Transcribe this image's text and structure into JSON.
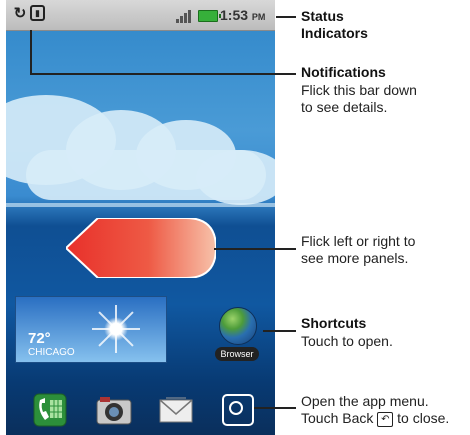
{
  "status_bar": {
    "time": "1:53",
    "ampm": "PM"
  },
  "weather_widget": {
    "temperature": "72°",
    "city": "CHICAGO"
  },
  "shortcut": {
    "label": "Browser"
  },
  "dock": {
    "icons": [
      "phone-icon",
      "camera-icon",
      "email-icon",
      "app-menu-icon"
    ]
  },
  "callouts": {
    "status": {
      "title_line1": "Status",
      "title_line2": "Indicators"
    },
    "notifications": {
      "title": "Notifications",
      "line1": "Flick this bar down",
      "line2": "to see details."
    },
    "panels": {
      "line1": "Flick left or right to",
      "line2": "see more panels."
    },
    "shortcuts": {
      "title": "Shortcuts",
      "line1": "Touch to open."
    },
    "app_menu": {
      "line1": "Open the app menu.",
      "line2_before": "Touch Back",
      "line2_after": "to close."
    }
  },
  "colors": {
    "arrow_red": "#e8302a",
    "battery_green": "#36b03a"
  }
}
